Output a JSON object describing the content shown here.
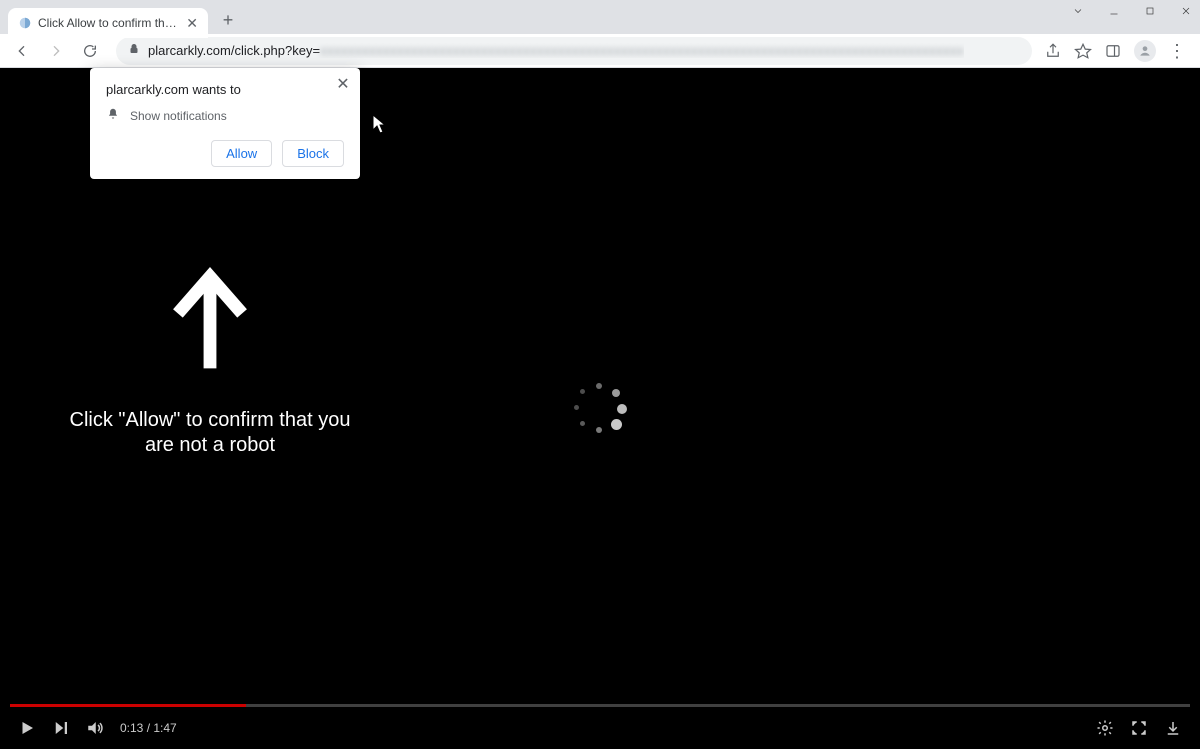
{
  "tab": {
    "title": "Click Allow to confirm that you a..."
  },
  "omnibox": {
    "url_visible": "plarcarkly.com/click.php?key=",
    "url_blurred": "xxxxxxxxxxxxxxxxxxxxxxxxxxxxxxxxxxxxxxxxxxxxxxxxxxxxxxxxxxxxxxxxxxxxxxxxxxxxxxxxxxxxxxxxxxxx"
  },
  "permission_popup": {
    "heading": "plarcarkly.com wants to",
    "row_label": "Show notifications",
    "allow_label": "Allow",
    "block_label": "Block"
  },
  "overlay": {
    "primary_text": "Click \"Allow\" to confirm that you are not a robot"
  },
  "video": {
    "time_current": "0:13",
    "time_total": "1:47",
    "time_display": "0:13 / 1:47",
    "progress_pct": 20
  }
}
